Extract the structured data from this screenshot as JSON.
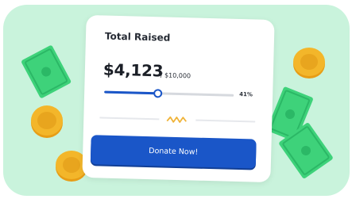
{
  "card": {
    "title": "Total Raised",
    "amount_raised": "$4,123",
    "goal": "/ $10,000",
    "progress_fraction": 0.41,
    "percent_label": "41%",
    "donate_label": "Donate Now!"
  },
  "colors": {
    "background": "#c9f3dc",
    "accent": "#1a56c8",
    "bill": "#3ed27a",
    "coin": "#f3b62a",
    "divider_wave": "#f0b43a"
  },
  "icons": [
    "dollar-bill-icon",
    "gold-coin-icon",
    "wave-divider-icon"
  ]
}
